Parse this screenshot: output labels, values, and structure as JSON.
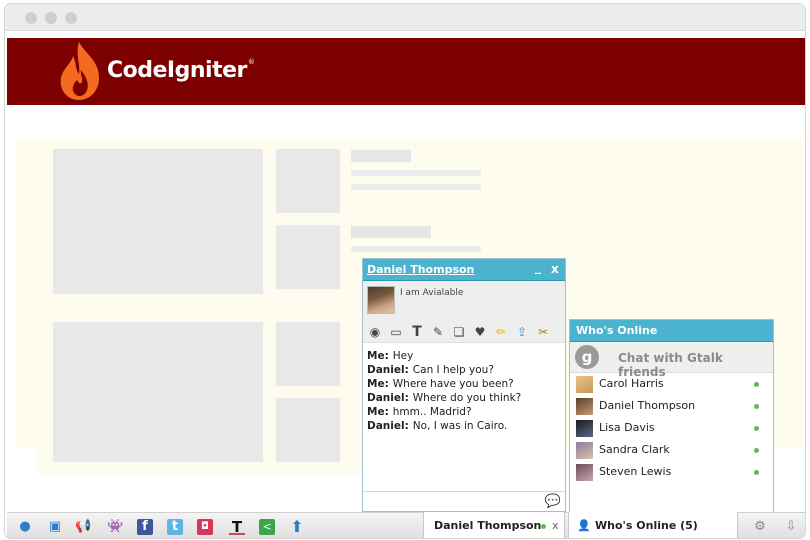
{
  "header": {
    "logo_text": "CodeIgniter",
    "logo_mark": "®"
  },
  "chat": {
    "contact_name": "Daniel Thompson",
    "minimize_label": "_",
    "close_label": "x",
    "status_message": "I am Avialable",
    "messages": [
      {
        "sender": "Me:",
        "text": "Hey"
      },
      {
        "sender": "Daniel:",
        "text": "Can I help you?"
      },
      {
        "sender": "Me:",
        "text": "Where have you been?"
      },
      {
        "sender": "Daniel:",
        "text": "Where do you think?"
      },
      {
        "sender": "Me:",
        "text": "hmm.. Madrid?"
      },
      {
        "sender": "Daniel:",
        "text": "No, I was in Cairo."
      }
    ]
  },
  "online": {
    "title": "Who's Online",
    "gtalk_label": "Chat with Gtalk friends",
    "g_letter": "g",
    "friends": [
      {
        "name": "Carol Harris"
      },
      {
        "name": "Daniel Thompson"
      },
      {
        "name": "Lisa Davis"
      },
      {
        "name": "Sandra Clark"
      },
      {
        "name": "Steven Lewis"
      }
    ]
  },
  "bar": {
    "chat_tab_label": "Daniel Thompson",
    "chat_tab_close": "x",
    "online_tab_label": "Who's Online (5)"
  },
  "colors": {
    "header": "#7c0000",
    "accent": "#4bb3cd",
    "online": "#58c04a"
  }
}
